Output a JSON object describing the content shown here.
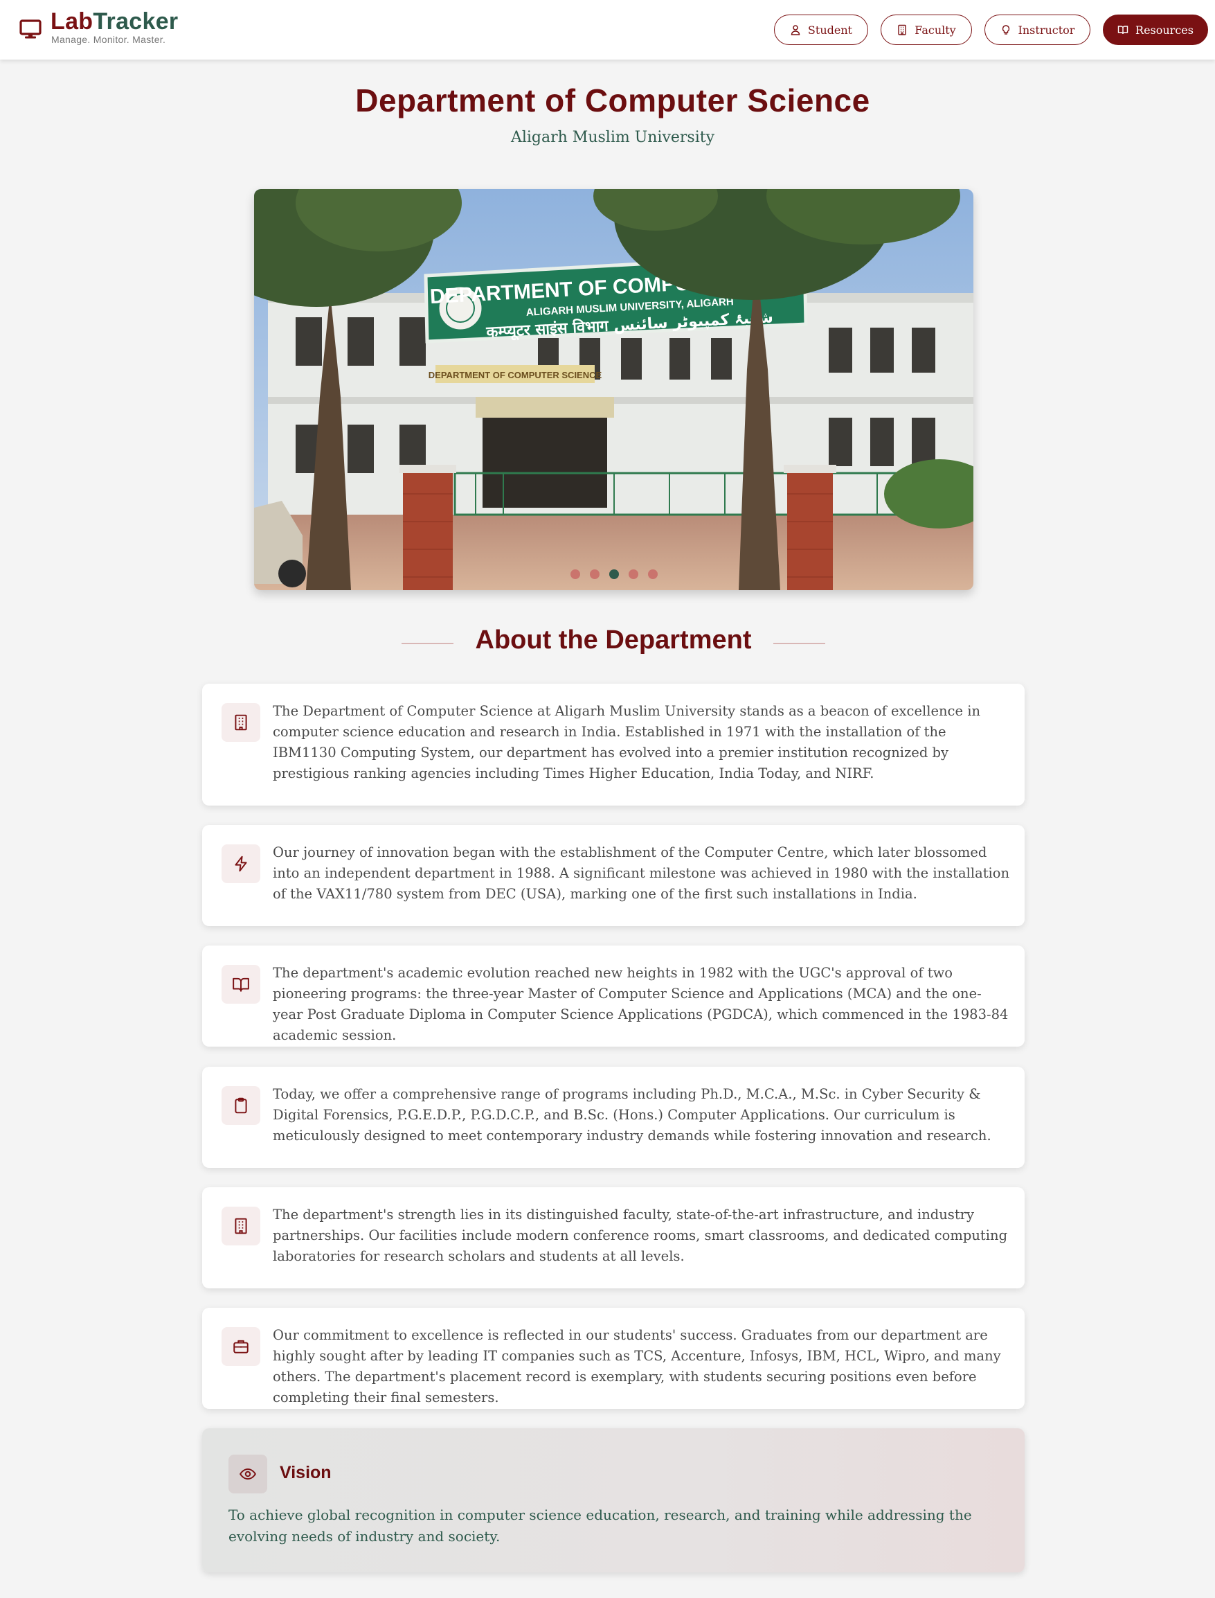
{
  "brand": {
    "name_part1": "Lab",
    "name_part2": "Tracker",
    "tagline": "Manage. Monitor. Master.",
    "icon": "monitor-icon"
  },
  "nav": {
    "items": [
      {
        "label": "Student",
        "icon": "user-icon",
        "active": false
      },
      {
        "label": "Faculty",
        "icon": "building-icon",
        "active": false
      },
      {
        "label": "Instructor",
        "icon": "lightbulb-icon",
        "active": false
      },
      {
        "label": "Resources",
        "icon": "book-open-icon",
        "active": true
      }
    ]
  },
  "header": {
    "title": "Department of Computer Science",
    "subtitle": "Aligarh Muslim University"
  },
  "carousel": {
    "image_sign_title": "DEPARTMENT OF COMPUTER SCIENCE",
    "image_sign_subtitle": "ALIGARH MUSLIM UNIVERSITY, ALIGARH",
    "image_sign_line3": "कम्प्यूटर साइंस विभाग  شعبۂ کمپیوٹر سائنس",
    "image_small_sign": "DEPARTMENT OF COMPUTER SCIENCE",
    "slide_count": 5,
    "active_slide": 3
  },
  "about": {
    "title": "About the Department",
    "cards": [
      {
        "icon": "building-icon",
        "text": "The Department of Computer Science at Aligarh Muslim University stands as a beacon of excellence in computer science education and research in India. Established in 1971 with the installation of the IBM1130 Computing System, our department has evolved into a premier institution recognized by prestigious ranking agencies including Times Higher Education, India Today, and NIRF."
      },
      {
        "icon": "lightning-icon",
        "text": "Our journey of innovation began with the establishment of the Computer Centre, which later blossomed into an independent department in 1988. A significant milestone was achieved in 1980 with the installation of the VAX11/780 system from DEC (USA), marking one of the first such installations in India."
      },
      {
        "icon": "book-open-icon",
        "text": "The department's academic evolution reached new heights in 1982 with the UGC's approval of two pioneering programs: the three-year Master of Computer Science and Applications (MCA) and the one-year Post Graduate Diploma in Computer Science Applications (PGDCA), which commenced in the 1983-84 academic session."
      },
      {
        "icon": "clipboard-icon",
        "text": "Today, we offer a comprehensive range of programs including Ph.D., M.C.A., M.Sc. in Cyber Security & Digital Forensics, P.G.E.D.P., P.G.D.C.P., and B.Sc. (Hons.) Computer Applications. Our curriculum is meticulously designed to meet contemporary industry demands while fostering innovation and research."
      },
      {
        "icon": "building-icon",
        "text": "The department's strength lies in its distinguished faculty, state-of-the-art infrastructure, and industry partnerships. Our facilities include modern conference rooms, smart classrooms, and dedicated computing laboratories for research scholars and students at all levels."
      },
      {
        "icon": "briefcase-icon",
        "text": "Our commitment to excellence is reflected in our students' success. Graduates from our department are highly sought after by leading IT companies such as TCS, Accenture, Infosys, IBM, HCL, Wipro, and many others. The department's placement record is exemplary, with students securing positions even before completing their final semesters."
      }
    ]
  },
  "vision": {
    "icon": "eye-icon",
    "title": "Vision",
    "text": "To achieve global recognition in computer science education, research, and training while addressing the evolving needs of industry and society."
  },
  "colors": {
    "primary": "#7a1113",
    "secondary": "#2e5a4c",
    "background": "#f4f4f4"
  }
}
